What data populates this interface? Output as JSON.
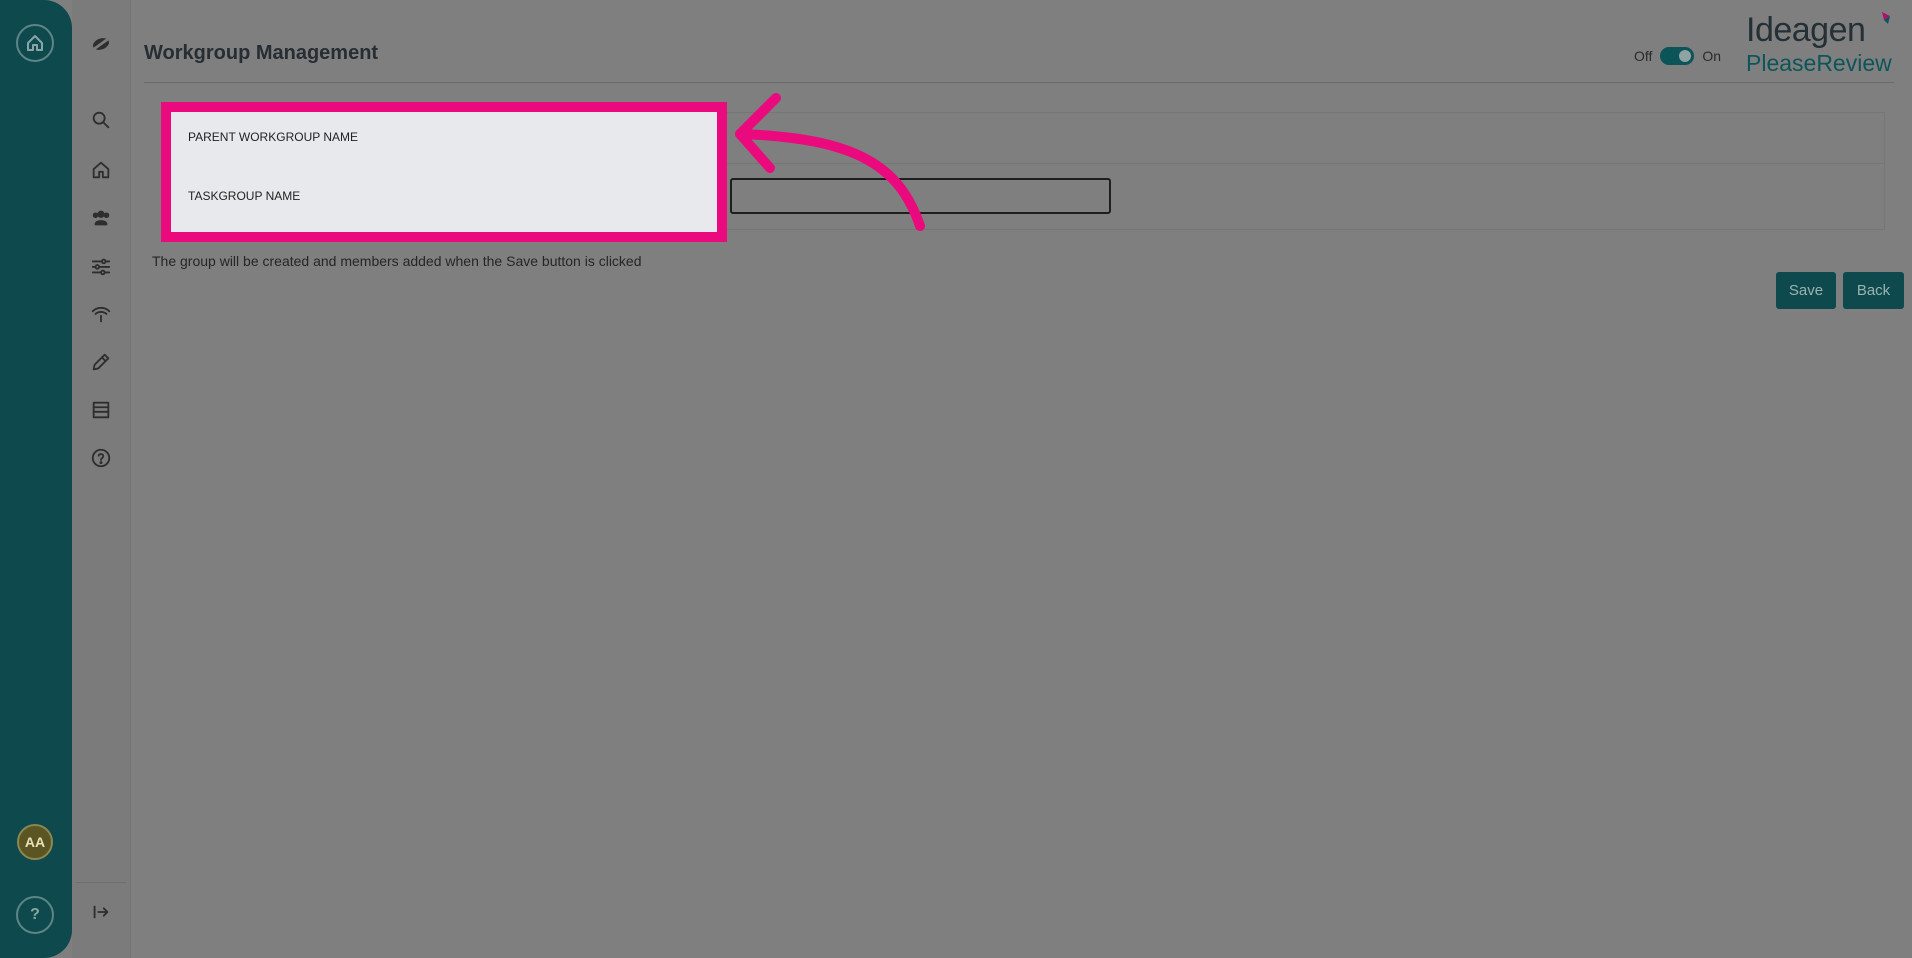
{
  "rail": {
    "home_icon": "home-icon",
    "avatar_initials": "AA",
    "help_label": "?"
  },
  "nav": {
    "items": [
      "logo-icon",
      "search-icon",
      "home-icon",
      "users-icon",
      "sliders-icon",
      "broadcast-icon",
      "pencil-icon",
      "list-icon",
      "help-icon"
    ],
    "collapse_icon": "collapse-icon"
  },
  "header": {
    "title": "Workgroup Management",
    "toggle_off": "Off",
    "toggle_on": "On",
    "toggle_state": "on",
    "brand": "Ideagen",
    "product": "PleaseReview"
  },
  "form": {
    "parent_label": "PARENT WORKGROUP NAME",
    "taskgroup_label": "TASKGROUP NAME",
    "taskgroup_value": ""
  },
  "info_text": "The group will be created and members added when the Save button is clicked",
  "buttons": {
    "save": "Save",
    "back": "Back"
  },
  "colors": {
    "accent": "#0e4a4d",
    "highlight": "#ea0a7e"
  }
}
